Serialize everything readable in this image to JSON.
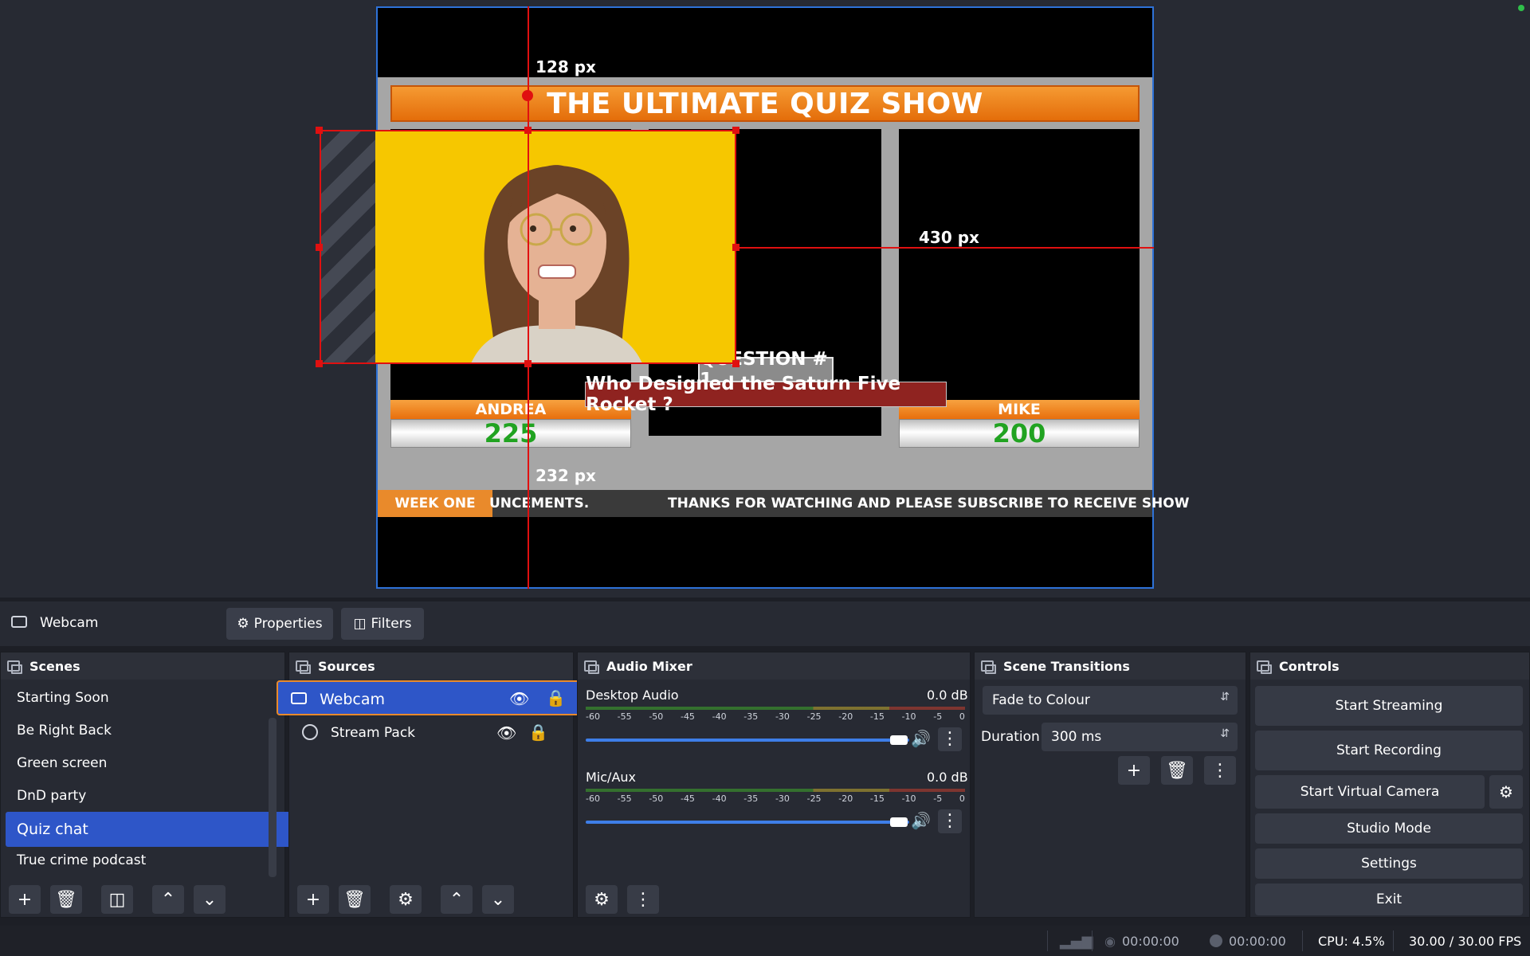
{
  "preview": {
    "overlay_title": "THE ULTIMATE QUIZ SHOW",
    "player_left_name": "ANDREA",
    "player_left_score": "225",
    "player_right_name": "MIKE",
    "player_right_score": "200",
    "question_number": "QUESTION # 1",
    "question_text": "Who Designed the Saturn Five Rocket ?",
    "ticker_label": "WEEK ONE",
    "ticker_text_1": "UNCEMENTS.",
    "ticker_text_2": "THANKS FOR WATCHING AND PLEASE SUBSCRIBE TO RECEIVE SHOW",
    "measure_top": "128 px",
    "measure_right": "430 px",
    "measure_bottom": "232 px"
  },
  "source_toolbar": {
    "source_name": "Webcam",
    "properties_label": "Properties",
    "filters_label": "Filters"
  },
  "scenes": {
    "title": "Scenes",
    "items": [
      "Starting Soon",
      "Be Right Back",
      "Green screen",
      "DnD party",
      "Quiz chat",
      "True crime podcast"
    ],
    "selected": "Quiz chat"
  },
  "sources": {
    "title": "Sources",
    "items": [
      {
        "name": "Webcam",
        "icon": "camera-icon"
      },
      {
        "name": "Stream Pack",
        "icon": "globe-icon"
      }
    ]
  },
  "audio_mixer": {
    "title": "Audio Mixer",
    "scale": [
      "-60",
      "-55",
      "-50",
      "-45",
      "-40",
      "-35",
      "-30",
      "-25",
      "-20",
      "-15",
      "-10",
      "-5",
      "0"
    ],
    "channels": [
      {
        "name": "Desktop Audio",
        "level": "0.0 dB"
      },
      {
        "name": "Mic/Aux",
        "level": "0.0 dB"
      }
    ]
  },
  "transitions": {
    "title": "Scene Transitions",
    "selected": "Fade to Colour",
    "duration_label": "Duration",
    "duration_value": "300 ms"
  },
  "controls": {
    "title": "Controls",
    "start_streaming": "Start Streaming",
    "start_recording": "Start Recording",
    "start_virtual_camera": "Start Virtual Camera",
    "studio_mode": "Studio Mode",
    "settings": "Settings",
    "exit": "Exit"
  },
  "status": {
    "stream_time": "00:00:00",
    "record_time": "00:00:00",
    "cpu": "CPU: 4.5%",
    "fps": "30.00 / 30.00 FPS"
  },
  "colors": {
    "accent": "#2e56c8",
    "selection": "#e01010",
    "canvas_border": "#2e72d8"
  }
}
